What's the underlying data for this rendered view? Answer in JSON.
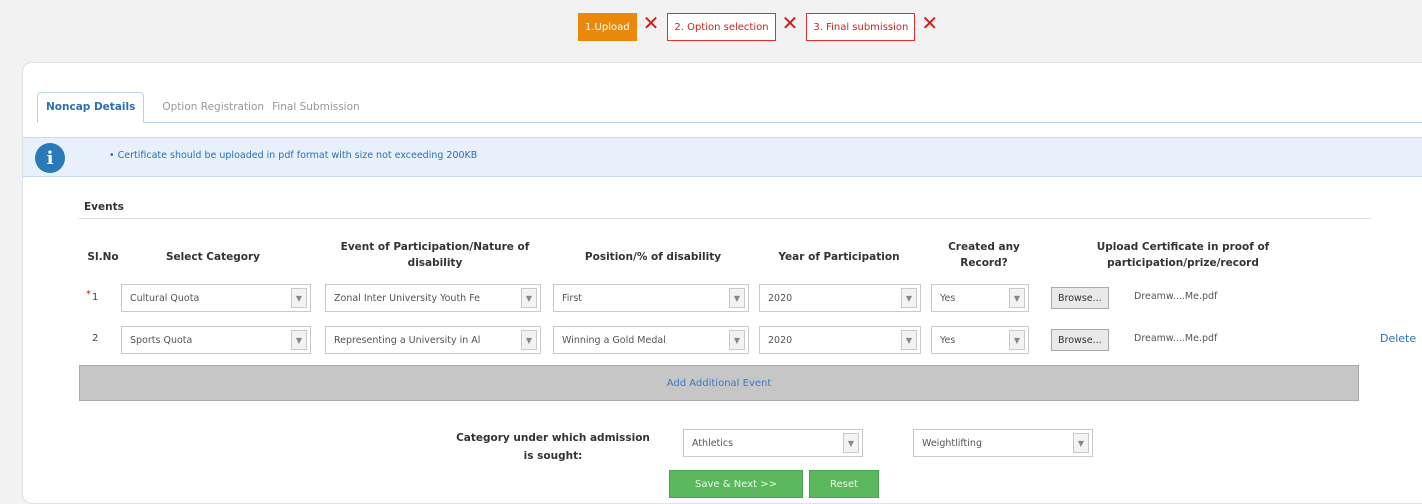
{
  "steps": [
    {
      "label": "1.Upload",
      "active": true
    },
    {
      "label": "2. Option selection",
      "active": false
    },
    {
      "label": "3. Final submission",
      "active": false
    }
  ],
  "tabs": [
    "Noncap Details",
    "Option Registration",
    "Final Submission"
  ],
  "info": {
    "text": "• Certificate should be uploaded in pdf format with size not exceeding 200KB"
  },
  "events": {
    "title": "Events",
    "headers": {
      "slno": "Sl.No",
      "category": "Select Category",
      "event_l1": "Event of Participation/Nature of",
      "event_l2": "disability",
      "position": "Position/% of disability",
      "year": "Year of Participation",
      "record_l1": "Created any",
      "record_l2": "Record?",
      "upload_l1": "Upload Certificate in proof of",
      "upload_l2": "participation/prize/record"
    },
    "rows": [
      {
        "slno": "1",
        "required": "*",
        "category": "Cultural Quota",
        "event": "Zonal Inter University Youth Fe",
        "position": "First",
        "year": "2020",
        "record": "Yes",
        "browse": "Browse...",
        "file": "Dreamw....Me.pdf",
        "delete": ""
      },
      {
        "slno": "2",
        "required": "",
        "category": "Sports Quota",
        "event": "Representing a University in Al",
        "position": "Winning a Gold Medal",
        "year": "2020",
        "record": "Yes",
        "browse": "Browse...",
        "file": "Dreamw....Me.pdf",
        "delete": "Delete"
      }
    ],
    "add_label": "Add Additional Event"
  },
  "admission": {
    "label_l1": "Category under which admission",
    "label_l2": "is sought:",
    "category": "Athletics",
    "subcategory": "Weightlifting"
  },
  "buttons": {
    "save": "Save & Next >>",
    "reset": "Reset"
  },
  "colors": {
    "step_active": "#e8890c",
    "step_border": "#dd3333",
    "accent": "#2a6fb8",
    "button_green": "#5cb85c",
    "info_bg": "#e8f1fb"
  }
}
